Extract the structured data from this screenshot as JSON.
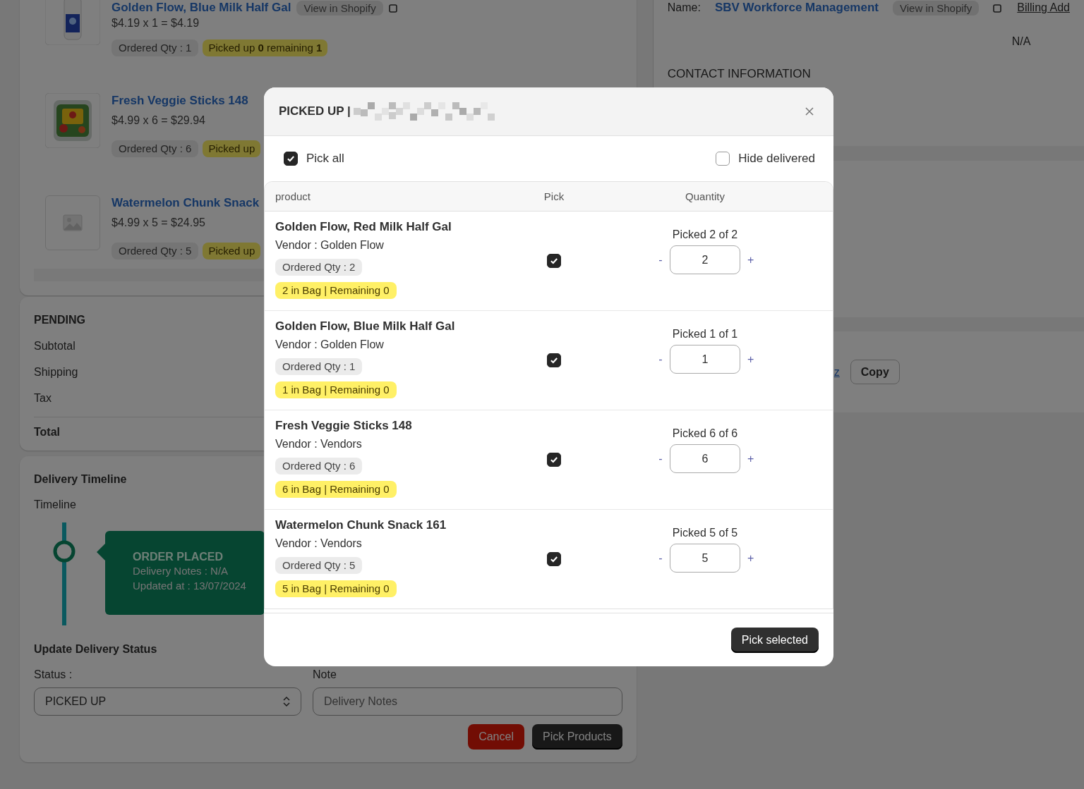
{
  "products": [
    {
      "name": "Golden Flow, Blue Milk Half Gal",
      "link": "View in Shopify",
      "price": "$4.19 x 1 = $4.19",
      "ordered": "Ordered Qty : 1",
      "picked": "Picked up **0** remaining **1**"
    },
    {
      "name": "Fresh Veggie Sticks 148",
      "price": "$4.99 x 6 = $29.94",
      "ordered": "Ordered Qty : 6",
      "picked": "Picked up"
    },
    {
      "name": "Watermelon Chunk Snack",
      "price": "$4.99 x 5 = $24.95",
      "ordered": "Ordered Qty : 5",
      "picked": "Picked up"
    }
  ],
  "summary": {
    "title": "PENDING",
    "rows": [
      "Subtotal",
      "Shipping",
      "Tax"
    ],
    "total": "Total"
  },
  "timeline": {
    "title": "Delivery Timeline",
    "label": "Timeline",
    "events": [
      {
        "status": "ORDER PLACED",
        "notes_label": "Delivery Notes :",
        "notes": "N/A",
        "updated": "Updated at : 13/07/2024"
      }
    ]
  },
  "update": {
    "title": "Update Delivery Status",
    "status_label": "Status :",
    "status_value": "PICKED UP",
    "note_label": "Note",
    "note_placeholder": "Delivery Notes",
    "buttons": [
      {
        "label": "Cancel",
        "kind": "danger"
      },
      {
        "label": "Pick Products",
        "kind": "primary"
      }
    ]
  },
  "customer": {
    "name_label": "Name:",
    "name": "SBV Workforce Management",
    "link": "View in Shopify",
    "billing": "Billing Add",
    "value": "N/A",
    "contact_title": "CONTACT INFORMATION",
    "link_fragment": "z",
    "copy": "Copy"
  },
  "modal": {
    "title": "PICKED UP |",
    "pick_all": {
      "label": "Pick all",
      "checked": true
    },
    "hide_delivered": {
      "label": "Hide delivered",
      "checked": false
    },
    "columns": [
      "product",
      "Pick",
      "Quantity"
    ],
    "rows": [
      {
        "name": "Golden Flow, Red Milk Half Gal",
        "vendor": "Vendor : Golden Flow",
        "ordered": "Ordered Qty : 2",
        "bag": "2 in Bag | Remaining 0",
        "checked": true,
        "picked": "Picked 2 of 2",
        "qty": "2",
        "minus": "-",
        "plus": "+"
      },
      {
        "name": "Golden Flow, Blue Milk Half Gal",
        "vendor": "Vendor : Golden Flow",
        "ordered": "Ordered Qty : 1",
        "bag": "1 in Bag | Remaining 0",
        "checked": true,
        "picked": "Picked 1 of 1",
        "qty": "1",
        "minus": "-",
        "plus": "+"
      },
      {
        "name": "Fresh Veggie Sticks 148",
        "vendor": "Vendor : Vendors",
        "ordered": "Ordered Qty : 6",
        "bag": "6 in Bag | Remaining 0",
        "checked": true,
        "picked": "Picked 6 of 6",
        "qty": "6",
        "minus": "-",
        "plus": "+"
      },
      {
        "name": "Watermelon Chunk Snack 161",
        "vendor": "Vendor : Vendors",
        "ordered": "Ordered Qty : 5",
        "bag": "5 in Bag | Remaining 0",
        "checked": true,
        "picked": "Picked 5 of 5",
        "qty": "5",
        "minus": "-",
        "plus": "+"
      }
    ],
    "submit": "Pick selected"
  }
}
